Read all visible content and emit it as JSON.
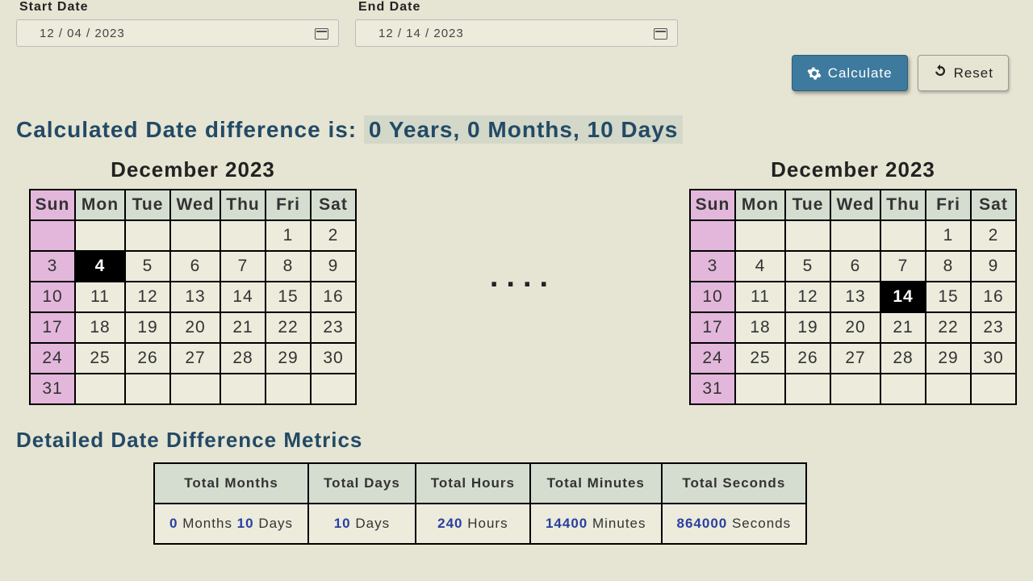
{
  "labels": {
    "start": "Start Date",
    "end": "End Date"
  },
  "inputs": {
    "start": "12 / 04 / 2023",
    "end": "12 / 14 / 2023"
  },
  "buttons": {
    "calculate": "Calculate",
    "reset": "Reset"
  },
  "result": {
    "prefix": "Calculated Date difference is:",
    "value": "0 Years, 0 Months, 10 Days"
  },
  "calendars": {
    "sep": "....",
    "headers": [
      "Sun",
      "Mon",
      "Tue",
      "Wed",
      "Thu",
      "Fri",
      "Sat"
    ],
    "left": {
      "title": "December 2023",
      "selected": 4,
      "weeks": [
        [
          "",
          "",
          "",
          "",
          "",
          "1",
          "2"
        ],
        [
          "3",
          "4",
          "5",
          "6",
          "7",
          "8",
          "9"
        ],
        [
          "10",
          "11",
          "12",
          "13",
          "14",
          "15",
          "16"
        ],
        [
          "17",
          "18",
          "19",
          "20",
          "21",
          "22",
          "23"
        ],
        [
          "24",
          "25",
          "26",
          "27",
          "28",
          "29",
          "30"
        ],
        [
          "31",
          "",
          "",
          "",
          "",
          "",
          ""
        ]
      ]
    },
    "right": {
      "title": "December 2023",
      "selected": 14,
      "weeks": [
        [
          "",
          "",
          "",
          "",
          "",
          "1",
          "2"
        ],
        [
          "3",
          "4",
          "5",
          "6",
          "7",
          "8",
          "9"
        ],
        [
          "10",
          "11",
          "12",
          "13",
          "14",
          "15",
          "16"
        ],
        [
          "17",
          "18",
          "19",
          "20",
          "21",
          "22",
          "23"
        ],
        [
          "24",
          "25",
          "26",
          "27",
          "28",
          "29",
          "30"
        ],
        [
          "31",
          "",
          "",
          "",
          "",
          "",
          ""
        ]
      ]
    }
  },
  "metrics": {
    "title": "Detailed Date Difference Metrics",
    "cols": [
      "Total Months",
      "Total Days",
      "Total Hours",
      "Total Minutes",
      "Total Seconds"
    ],
    "cells": [
      [
        {
          "n": "0",
          "u": "Months"
        },
        {
          "n": "10",
          "u": "Days"
        }
      ],
      [
        {
          "n": "10",
          "u": "Days"
        }
      ],
      [
        {
          "n": "240",
          "u": "Hours"
        }
      ],
      [
        {
          "n": "14400",
          "u": "Minutes"
        }
      ],
      [
        {
          "n": "864000",
          "u": "Seconds"
        }
      ]
    ]
  }
}
